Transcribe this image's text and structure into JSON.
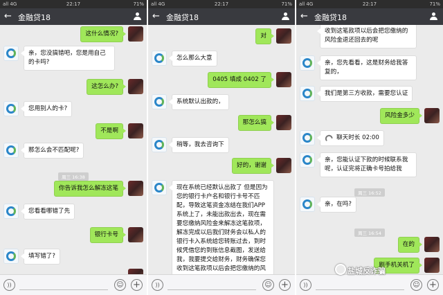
{
  "status": {
    "signal": "all 4G",
    "time": "22:17",
    "battery": "71%"
  },
  "chat_title": "金融贷18",
  "panels": [
    {
      "messages": [
        {
          "side": "out",
          "text": "这什么情况?"
        },
        {
          "side": "in",
          "text": "亲，您没搞错吧，您是用自己的卡吗?"
        },
        {
          "side": "out",
          "text": "这怎么办?"
        },
        {
          "side": "in",
          "text": "您用别人的卡?"
        },
        {
          "side": "out",
          "text": "不是啊"
        },
        {
          "side": "in",
          "text": "那怎么会不匹配呢?"
        },
        {
          "side": "time",
          "text": "周三 16:38"
        },
        {
          "side": "out",
          "text": "你告诉我怎么解冻这笔"
        },
        {
          "side": "in",
          "text": "您看看哪错了先"
        },
        {
          "side": "out",
          "text": "银行卡号"
        },
        {
          "side": "in",
          "text": "填写错了?"
        }
      ]
    },
    {
      "messages": [
        {
          "side": "out",
          "text": "对"
        },
        {
          "side": "in",
          "text": "怎么那么大意"
        },
        {
          "side": "out",
          "text": "0405 填成 0402 了"
        },
        {
          "side": "in",
          "text": "系统默认出款的，"
        },
        {
          "side": "out",
          "text": "那怎么搞"
        },
        {
          "side": "in",
          "text": "稍等，我去咨询下"
        },
        {
          "side": "out",
          "text": "好的，谢谢"
        },
        {
          "side": "in",
          "text": "现在系统已经默认出款了 但是因为您的银行卡户名和银行卡号不匹配，导致这笔资金冻结在我们APP系统上了，未能出款出去，现在需要您缴纳风险金来解冻这笔款项，解冻完成以后我们财务会以私人的银行卡入系统给您转账过去，到时候凭借您的到账信息截图，发送给我，我要提交给财务，财务确保您收到这笔款项以后会把您缴纳的风"
        }
      ]
    },
    {
      "messages": [
        {
          "side": "in",
          "text": "收到这笔款项以后会把您缴纳的风险金退还回去的呢"
        },
        {
          "side": "in",
          "text": "亲，您先看看，这是财务给我答复的，"
        },
        {
          "side": "in",
          "text": "我们是第三方收款，需要您认证"
        },
        {
          "side": "out",
          "text": "风险金多少"
        },
        {
          "side": "call",
          "text": "聊天时长 02:00"
        },
        {
          "side": "in",
          "text": "亲，您能认证下款的时候联系我呢，认证完将正确卡号拍给我"
        },
        {
          "side": "time",
          "text": "周三 16:52"
        },
        {
          "side": "in",
          "text": "亲，在吗?"
        },
        {
          "side": "time",
          "text": "周三 16:54"
        },
        {
          "side": "out",
          "text": "在的"
        },
        {
          "side": "out",
          "text": "刷手机关机了"
        }
      ]
    }
  ],
  "input_bar": {
    "voice_icon": "voice-icon",
    "emoji_icon": "emoji-icon",
    "plus_icon": "plus-icon"
  },
  "watermark": "盐城反诈骗"
}
